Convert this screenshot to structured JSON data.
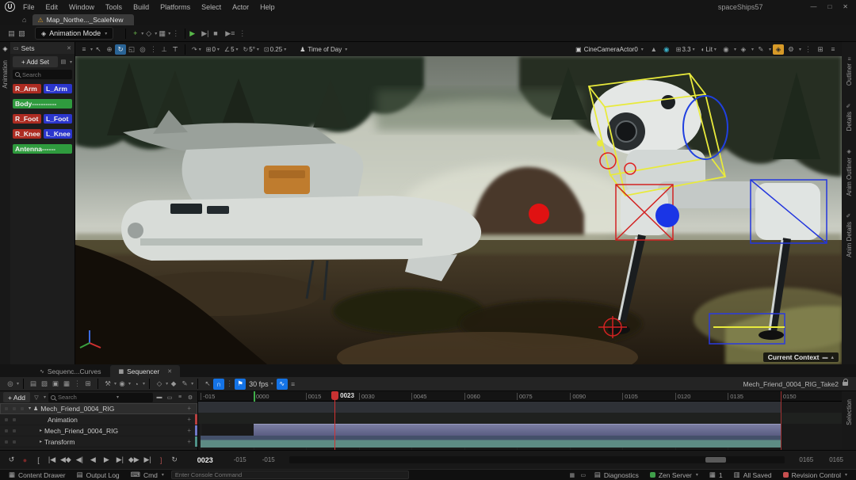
{
  "window": {
    "project_name": "spaceShips57",
    "menus": [
      "File",
      "Edit",
      "Window",
      "Tools",
      "Build",
      "Platforms",
      "Select",
      "Actor",
      "Help"
    ],
    "level_tab": "Map_Northe..._ScaleNew"
  },
  "toolbar": {
    "mode_label": "Animation Mode"
  },
  "sets_panel": {
    "vertical_tab": "Animation",
    "title": "Sets",
    "add_button": "+ Add Set",
    "search_placeholder": "Search",
    "items": [
      {
        "label": "R_Arm",
        "color": "red"
      },
      {
        "label": "L_Arm",
        "color": "blue"
      },
      {
        "label": "Body-----------",
        "color": "green"
      },
      {
        "label": "R_Foot",
        "color": "red"
      },
      {
        "label": "L_Foot",
        "color": "blue"
      },
      {
        "label": "R_Knee",
        "color": "red"
      },
      {
        "label": "L_Knee",
        "color": "blue"
      },
      {
        "label": "Antenna------",
        "color": "green"
      }
    ]
  },
  "viewport_toolbar": {
    "snap_values": [
      "0",
      "5",
      "5°",
      "0.25"
    ],
    "time_of_day": "Time of Day",
    "camera_actor": "CineCameraActor0",
    "screen_percentage": "3.3",
    "view_mode": "Lit"
  },
  "right_tabs": {
    "items": [
      "Outliner",
      "Details",
      "Anim Outliner",
      "Anim Details"
    ]
  },
  "overlay": {
    "current_context": "Current Context"
  },
  "sequencer": {
    "tabs": [
      {
        "label": "Sequenc...Curves"
      },
      {
        "label": "Sequencer"
      }
    ],
    "take_name": "Mech_Friend_0004_RIG_Take2",
    "fps": "30 fps",
    "add_label": "+ Add",
    "search_placeholder": "Search",
    "tracks": [
      {
        "label": "Mech_Friend_0004_RIG"
      },
      {
        "label": "Animation"
      },
      {
        "label": "Mech_Friend_0004_RIG"
      },
      {
        "label": "Transform"
      }
    ],
    "ruler_ticks": [
      "-015",
      "0000",
      "0015",
      "0030",
      "0045",
      "0060",
      "0075",
      "0090",
      "0105",
      "0120",
      "0135",
      "0150"
    ],
    "playhead_frame": "0023",
    "current_frame": "0023",
    "view_range_start": "-015",
    "working_range_start": "-015",
    "working_range_end": "0165",
    "view_range_end": "0165",
    "selection_tab": "Selection"
  },
  "statusbar": {
    "content_drawer": "Content Drawer",
    "output_log": "Output Log",
    "cmd": "Cmd",
    "console_placeholder": "Enter Console Command",
    "diagnostics": "Diagnostics",
    "zen_server": "Zen Server",
    "badge_count": "1",
    "all_saved": "All Saved",
    "revision_control": "Revision Control"
  },
  "colors": {
    "accent_blue": "#1473e6",
    "highlight_yellow": "#d79a28",
    "play_green": "#58b849",
    "set_red": "#ad2c22",
    "set_blue": "#2b36cd",
    "set_green": "#2f9b3e",
    "track_purple": "#7078c8",
    "track_teal": "#4f9288",
    "playhead_red": "#d23232",
    "range_green": "#3fae4a",
    "range_red": "#a03030",
    "gizmo_red": "#e01212",
    "gizmo_blue": "#1a35e6",
    "wire_yellow": "#e8ea3c"
  },
  "icons": {
    "logo": "U",
    "home": "⌂",
    "warning": "⚠",
    "caret": "▾",
    "caret_up": "▴",
    "caret_right": "▸",
    "dots": "⋮",
    "close": "✕",
    "minimize": "—",
    "maximize": "□",
    "save": "▤",
    "folder": "▧",
    "mode": "◈",
    "add": "+",
    "blueprint": "◇",
    "cinematics": "▦",
    "play": "▶",
    "skip": "▶|",
    "stop": "■",
    "launch": "▶≡",
    "menu": "≡",
    "select": "↖",
    "move": "⊕",
    "rotate": "↻",
    "scale": "◱",
    "world": "◎",
    "snap_floor": "⊥",
    "snap_actor": "⊤",
    "surface_snap": "↷",
    "grid_snap": "⊞",
    "angle_snap": "∠",
    "rot_snap": "↻",
    "scale_snap": "⊡",
    "person": "♟",
    "camera": "▣",
    "eject": "▲",
    "pilot": "◉",
    "layout": "⊞",
    "lit": "◐",
    "eye": "◉",
    "pen": "✎",
    "gear": "⚙",
    "grid4": "⊞",
    "magnet": "∩",
    "flag": "⚑",
    "curve": "∿",
    "wrench": "⚒",
    "keyframe": "◇",
    "autokey": "◆",
    "playback": "◔",
    "render": "⊞",
    "tracks_list": "≡",
    "filter": "▽",
    "bar1": "▬",
    "bar2": "▭",
    "to_start": "|◀",
    "prev_key": "◀◆",
    "step_back": "◀|",
    "play_rev": "◀",
    "step_fwd": "▶|",
    "next_key": "◆▶",
    "to_end": "▶|",
    "bracket_in": "[",
    "bracket_out": "]",
    "loop": "↻",
    "refresh": "↺",
    "record": "●",
    "keyboard": "⌨",
    "drawer": "▦",
    "log": "▤",
    "saved": "▥",
    "diag": "▤",
    "badge": "▦"
  }
}
